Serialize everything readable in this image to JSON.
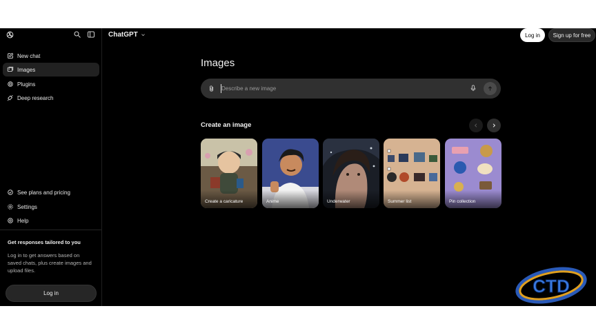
{
  "sidebar": {
    "items": [
      {
        "label": "New chat",
        "icon": "new-chat-icon"
      },
      {
        "label": "Images",
        "icon": "images-icon"
      },
      {
        "label": "Plugins",
        "icon": "plugins-icon"
      },
      {
        "label": "Deep research",
        "icon": "deep-research-icon"
      }
    ],
    "bottom_items": [
      {
        "label": "See plans and pricing",
        "icon": "plans-icon"
      },
      {
        "label": "Settings",
        "icon": "settings-icon"
      },
      {
        "label": "Help",
        "icon": "help-icon"
      }
    ],
    "promo": {
      "title": "Get responses tailored to you",
      "text": "Log in to get answers based on saved chats, plus create images and upload files."
    },
    "login_label": "Log in"
  },
  "header": {
    "model_name": "ChatGPT",
    "login_label": "Log in",
    "signup_label": "Sign up for free"
  },
  "main": {
    "title": "Images",
    "prompt_placeholder": "Describe a new image",
    "section_title": "Create an image",
    "cards": [
      {
        "label": "Create a caricature"
      },
      {
        "label": "Anime"
      },
      {
        "label": "Underwater"
      },
      {
        "label": "Summer list"
      },
      {
        "label": "Pin collection"
      }
    ]
  },
  "watermark": {
    "text": "CTD"
  },
  "colors": {
    "background": "#000000",
    "sidebar_active": "#212121",
    "input_bg": "#303030",
    "accent_white": "#ffffff"
  }
}
